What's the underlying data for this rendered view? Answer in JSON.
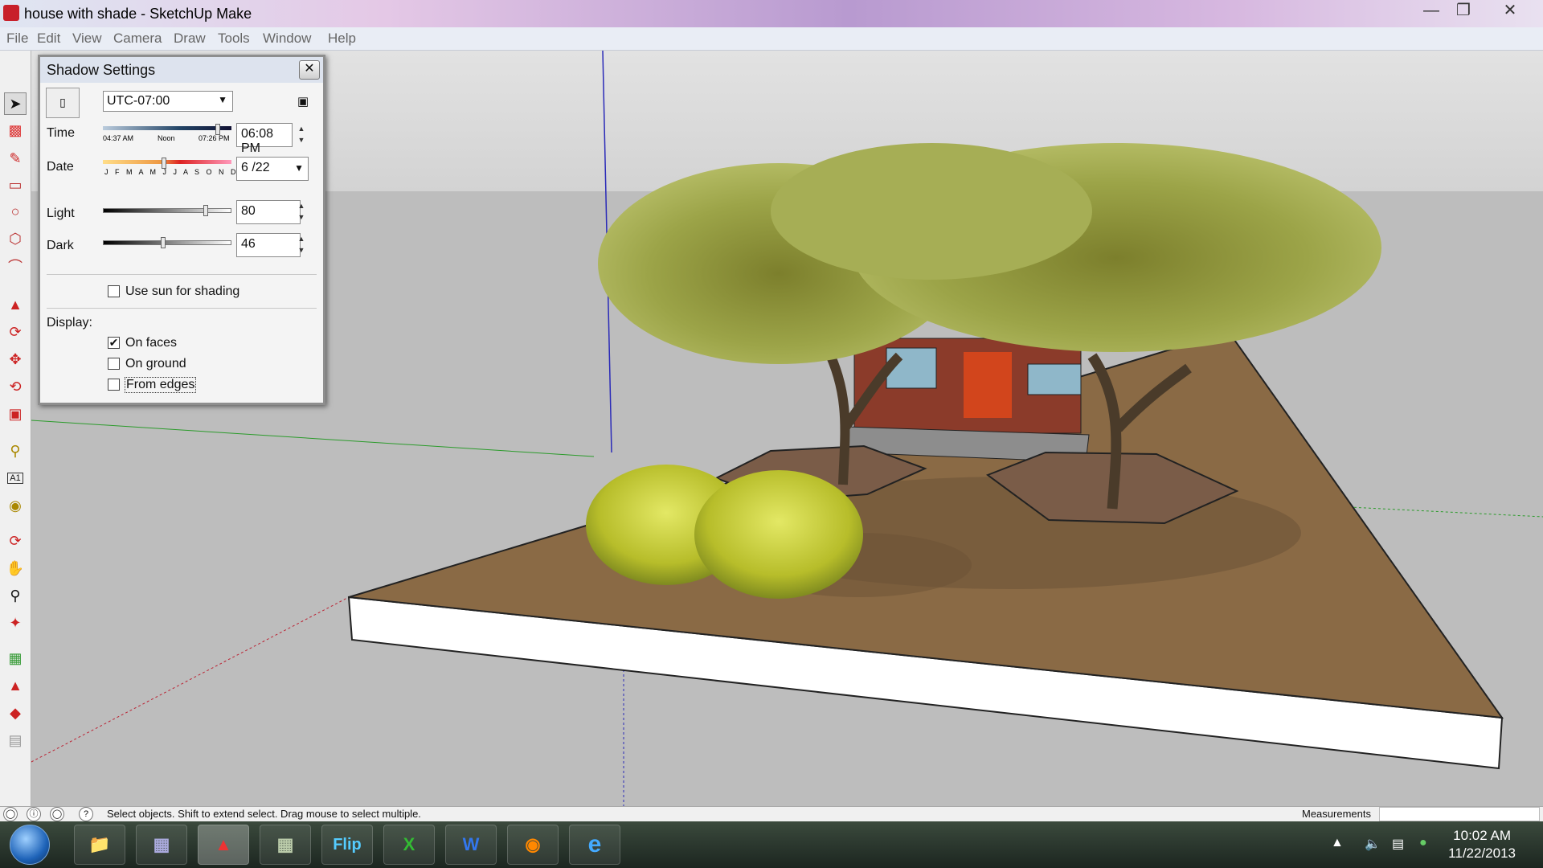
{
  "window": {
    "title": "house with shade - SketchUp Make",
    "minimize_icon": "minimize-icon",
    "maximize_icon": "restore-icon",
    "close_icon": "close-icon"
  },
  "menu": [
    "File",
    "Edit",
    "View",
    "Camera",
    "Draw",
    "Tools",
    "Window",
    "Help"
  ],
  "toolbar": {
    "tools": [
      "select-icon",
      "eraser-icon",
      "pencil-icon",
      "rectangle-icon",
      "circle-icon",
      "polygon-icon",
      "arc-icon",
      "push-pull-icon",
      "follow-me-icon",
      "move-icon",
      "rotate-icon",
      "scale-icon",
      "tape-measure-icon",
      "text-icon",
      "paint-bucket-icon",
      "orbit-icon",
      "pan-icon",
      "zoom-icon",
      "zoom-extents-icon",
      "map-icon",
      "warehouse-icon",
      "extension-icon",
      "layout-icon"
    ],
    "selected": "select-icon"
  },
  "shadow_settings": {
    "title": "Shadow Settings",
    "timezone": "UTC-07:00",
    "time_label": "Time",
    "time_ticks": [
      "04:37 AM",
      "Noon",
      "07:26 PM"
    ],
    "time_value": "06:08 PM",
    "time_fraction": 0.9,
    "date_label": "Date",
    "date_ticks": "J F M A M J J A S O N D",
    "date_value": "6 /22",
    "date_fraction": 0.47,
    "light_label": "Light",
    "light_value": "80",
    "dark_label": "Dark",
    "dark_value": "46",
    "use_sun_label": "Use sun for shading",
    "use_sun_checked": false,
    "display_label": "Display:",
    "on_faces_label": "On faces",
    "on_faces_checked": true,
    "on_ground_label": "On ground",
    "on_ground_checked": false,
    "from_edges_label": "From edges",
    "from_edges_checked": false,
    "check_mark": "✔"
  },
  "statusbar": {
    "message": "Select objects. Shift to extend select. Drag mouse to select multiple.",
    "measurements_label": "Measurements",
    "help_icon": "?"
  },
  "taskbar": {
    "apps": [
      "windows-explorer-icon",
      "network-icon",
      "sketchup-icon",
      "sketchup-ruby-icon",
      "flip-video-icon",
      "excel-icon",
      "word-icon",
      "firefox-icon",
      "internet-explorer-icon"
    ],
    "flip_label": "Flip",
    "excel_label": "X",
    "word_label": "W",
    "ie_label": "e",
    "clock_time": "10:02 AM",
    "clock_date": "11/22/2013"
  },
  "colors": {
    "ground": "#8a6a45",
    "slab_side": "#ffffff",
    "foliage": "#8f9a3a",
    "sky": "#d9d9d9",
    "grass": "#bdbdbd"
  }
}
